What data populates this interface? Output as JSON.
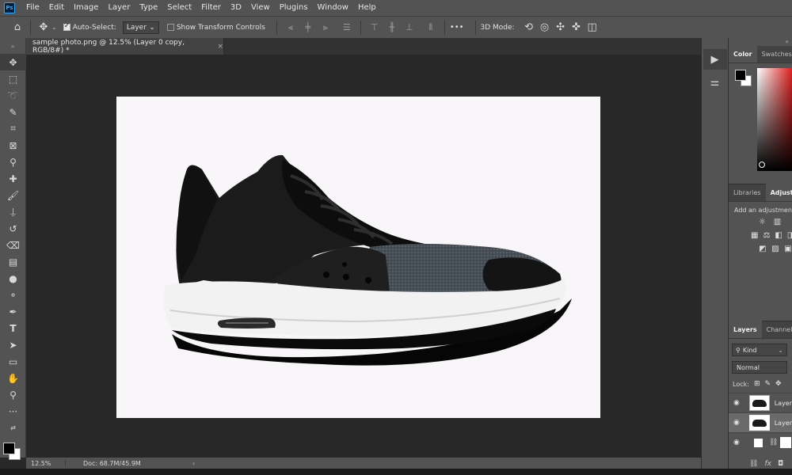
{
  "app": {
    "logo": "Ps",
    "menu": [
      "File",
      "Edit",
      "Image",
      "Layer",
      "Type",
      "Select",
      "Filter",
      "3D",
      "View",
      "Plugins",
      "Window",
      "Help"
    ]
  },
  "options_bar": {
    "auto_select_label": "Auto-Select:",
    "auto_select_checked": true,
    "target_value": "Layer",
    "show_transform_label": "Show Transform Controls",
    "show_transform_checked": false,
    "more_label": "•••",
    "mode_3d_label": "3D Mode:"
  },
  "document_tab": {
    "title": "sample photo.png @ 12.5% (Layer 0 copy, RGB/8#) *",
    "close": "×"
  },
  "status_bar": {
    "zoom": "12.5%",
    "doc_size": "Doc: 68.7M/45.9M",
    "arrow": "›"
  },
  "panels": {
    "collapse": "«",
    "color_tabs": [
      "Color",
      "Swatches"
    ],
    "adjust_tabs": [
      "Libraries",
      "Adjust"
    ],
    "adjust_hint": "Add an adjustment",
    "layers_tabs": [
      "Layers",
      "Channels"
    ],
    "kind_filter": "Kind",
    "blend_mode": "Normal",
    "lock_label": "Lock:",
    "layers": [
      {
        "name": "Layer",
        "selected": false
      },
      {
        "name": "Layer",
        "selected": true
      }
    ]
  },
  "colors": {
    "foreground": "#000000",
    "background": "#ffffff",
    "ui_dark": "#282828",
    "ui_panel": "#535353"
  }
}
